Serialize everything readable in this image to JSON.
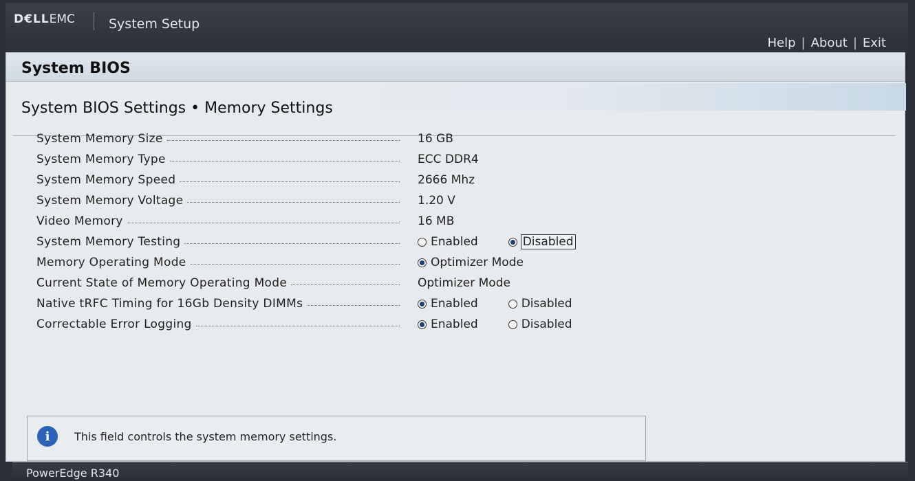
{
  "topbar": {
    "brand_bold": "D€LL",
    "brand_thin": "EMC",
    "app_title": "System Setup",
    "links": [
      "Help",
      "About",
      "Exit"
    ],
    "separator": "|"
  },
  "header": {
    "title": "System BIOS"
  },
  "section": {
    "title": "System BIOS Settings • Memory Settings"
  },
  "settings": [
    {
      "label": "System Memory Size",
      "value": "16 GB"
    },
    {
      "label": "System Memory Type",
      "value": "ECC DDR4"
    },
    {
      "label": "System Memory Speed",
      "value": "2666 Mhz"
    },
    {
      "label": "System Memory Voltage",
      "value": "1.20 V"
    },
    {
      "label": "Video Memory",
      "value": "16 MB"
    },
    {
      "label": "System Memory Testing",
      "options": [
        "Enabled",
        "Disabled"
      ],
      "selected": "Disabled"
    },
    {
      "label": "Memory Operating Mode",
      "options": [
        "Optimizer Mode"
      ],
      "selected": "Optimizer Mode"
    },
    {
      "label": "Current State of Memory Operating Mode",
      "value": "Optimizer Mode"
    },
    {
      "label": "Native tRFC Timing for 16Gb Density DIMMs",
      "options": [
        "Enabled",
        "Disabled"
      ],
      "selected": "Enabled"
    },
    {
      "label": "Correctable Error Logging",
      "options": [
        "Enabled",
        "Disabled"
      ],
      "selected": "Enabled"
    }
  ],
  "info": {
    "icon": "info-icon",
    "icon_glyph": "i",
    "text": "This field controls the system memory settings."
  },
  "footer": {
    "model": "PowerEdge R340"
  },
  "colors": {
    "accent": "#2a63b8",
    "bar": "#2b2f38"
  }
}
